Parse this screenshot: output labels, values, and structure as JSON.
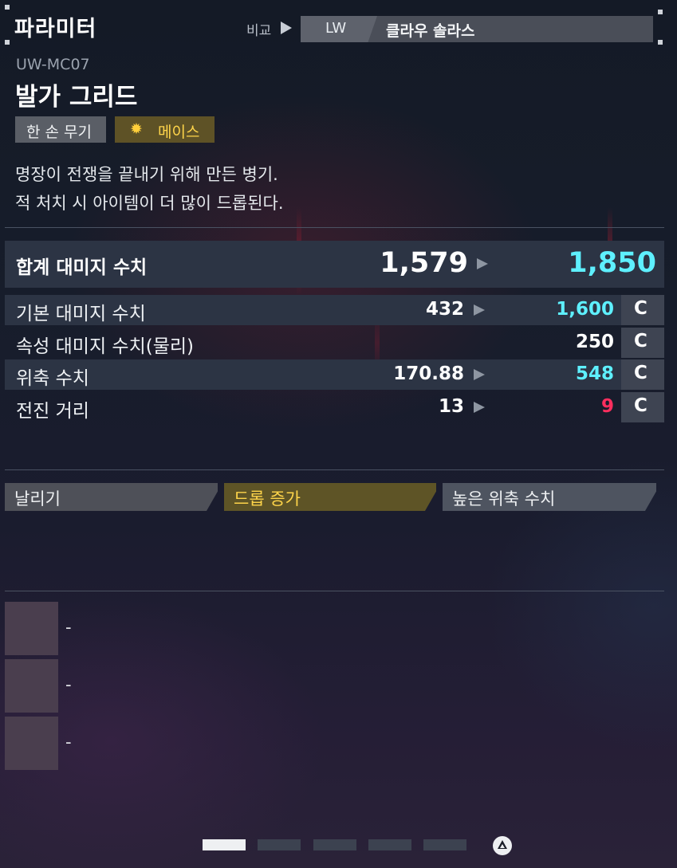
{
  "header": {
    "title": "파라미터",
    "compare_label": "비교",
    "compare_slot": "LW",
    "compare_item": "클라우 솔라스"
  },
  "item": {
    "code": "UW-MC07",
    "name": "발가 그리드",
    "tags": [
      {
        "label": "한 손 무기"
      },
      {
        "icon": "burst-icon",
        "label": "메이스",
        "color": "#ffd54a"
      }
    ],
    "description": [
      "명장이 전쟁을 끝내기 위해 만든 병기.",
      "적 처치 시 아이템이 더 많이 드롭된다."
    ]
  },
  "stats": {
    "total": {
      "label": "합계 대미지 수치",
      "current": "1,579",
      "compare": "1,850",
      "compare_color": "#5ef0ff"
    },
    "rows": [
      {
        "label": "기본 대미지 수치",
        "current": "432",
        "compare": "1,600",
        "compare_color": "#5ef0ff",
        "grade": "C"
      },
      {
        "label": "속성 대미지 수치(물리)",
        "current": "",
        "compare": "250",
        "compare_color": "#ffffff",
        "grade": "C"
      },
      {
        "label": "위축 수치",
        "current": "170.88",
        "compare": "548",
        "compare_color": "#5ef0ff",
        "grade": "C"
      },
      {
        "label": "전진 거리",
        "current": "13",
        "compare": "9",
        "compare_color": "#ff2e5e",
        "grade": "C"
      }
    ]
  },
  "attributes": [
    {
      "label": "날리기",
      "bg": "#4e5058",
      "color": "#eef0f2"
    },
    {
      "label": "드롭 증가",
      "bg": "#5e5426",
      "color": "#ffd54a"
    },
    {
      "label": "높은 위축 수치",
      "bg": "#4e5460",
      "color": "#eef0f2"
    }
  ],
  "slots": [
    {
      "value": "-"
    },
    {
      "value": "-"
    },
    {
      "value": "-"
    }
  ],
  "pager": {
    "pages": 5,
    "active": 1,
    "button_icon": "triangle-button-icon"
  }
}
